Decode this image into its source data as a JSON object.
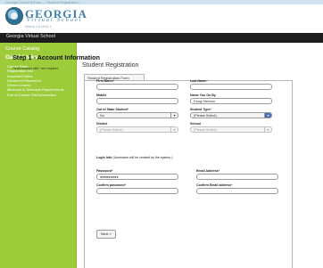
{
  "header": {
    "top_strip": "Georgia Virtual School — Student Registration",
    "brand_name": "GEORGIA",
    "brand_sub": "Virtual School",
    "contact": "Search  1-8  (404) 4"
  },
  "navbar": {
    "title": "Georgia Virtual School"
  },
  "sidebar": {
    "catalog_label": "Course Catalog",
    "links_title": "GaVS Links",
    "items": [
      "Course Fees",
      "Registration Info",
      "Important Dates",
      "Advanced Placement",
      "Drivers Course",
      "Minimum & Technical Requirements",
      "End of Course Test Information"
    ]
  },
  "main": {
    "title": "Student Registration",
    "tab_label": "Student Registration Form",
    "step_title": "Step 1 - Account Information",
    "required_note": "Fields marked with * are required."
  },
  "form": {
    "first_name": {
      "label": "First Name",
      "value": ""
    },
    "last_name": {
      "label": "Last Name",
      "value": ""
    },
    "middle": {
      "label": "Middle",
      "value": ""
    },
    "name_you_go_by": {
      "label": "Name You Go By",
      "value": "Doug Gleeson"
    },
    "out_of_state": {
      "label": "Out of State Student",
      "value": "No"
    },
    "student_type": {
      "label": "Student Type",
      "value": "(Please Select)"
    },
    "district": {
      "label": "District",
      "value": "(Please Select)"
    },
    "school": {
      "label": "School",
      "value": "(Please Select)"
    },
    "login_info": {
      "bold": "Login Info",
      "rest": " (Username will be created by the system.)"
    },
    "password": {
      "label": "Password",
      "value": "●●●●●●●●●"
    },
    "email": {
      "label": "Email Address",
      "value": ""
    },
    "confirm_password": {
      "label": "Confirm password",
      "value": ""
    },
    "confirm_email": {
      "label": "Confirm Email address",
      "value": ""
    },
    "required_star": "*"
  },
  "buttons": {
    "next": "Next >"
  },
  "icons": {
    "dropdown": "chevron-down-icon",
    "logo": "georgia-emblem-icon"
  }
}
